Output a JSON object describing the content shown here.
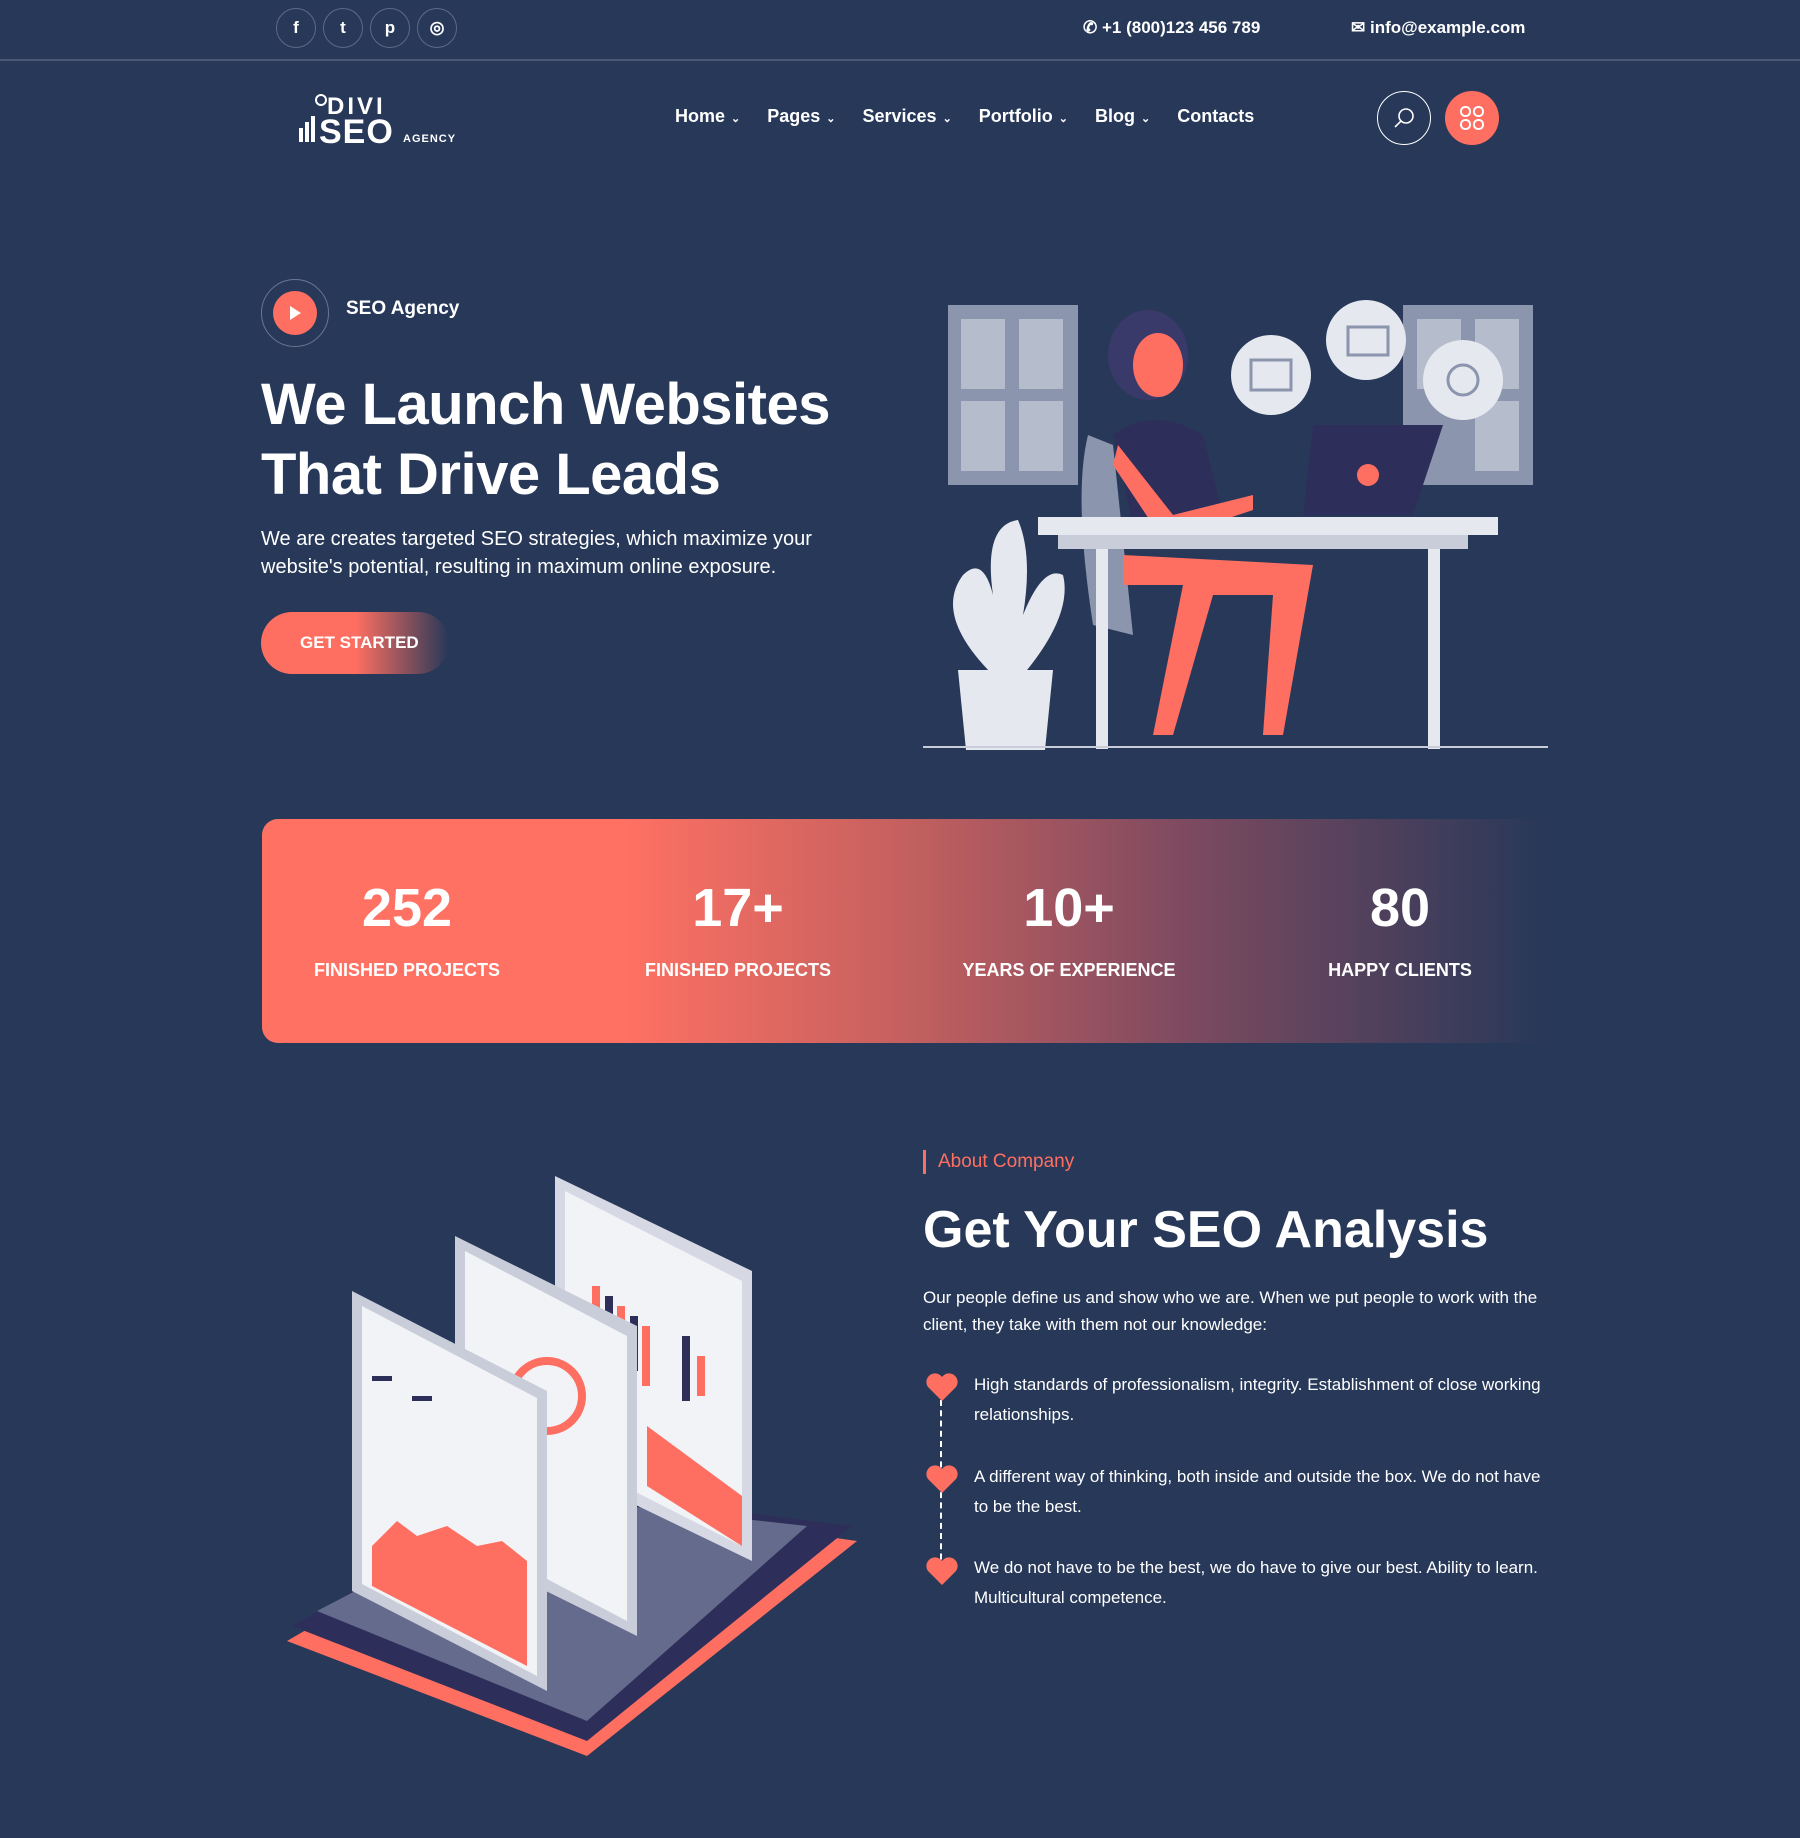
{
  "topbar": {
    "social": [
      {
        "icon": "facebook-icon",
        "glyph": "f"
      },
      {
        "icon": "twitter-icon",
        "glyph": "t"
      },
      {
        "icon": "pinterest-icon",
        "glyph": "p"
      },
      {
        "icon": "instagram-icon",
        "glyph": "◎"
      }
    ],
    "phone": "+1 (800)123 456 789",
    "email": "info@example.com"
  },
  "header": {
    "logo": {
      "line1": "DIVI",
      "line2": "SEO",
      "line3": "AGENCY"
    },
    "nav": [
      {
        "label": "Home",
        "dropdown": true
      },
      {
        "label": "Pages",
        "dropdown": true
      },
      {
        "label": "Services",
        "dropdown": true
      },
      {
        "label": "Portfolio",
        "dropdown": true
      },
      {
        "label": "Blog",
        "dropdown": true
      },
      {
        "label": "Contacts",
        "dropdown": false
      }
    ]
  },
  "hero": {
    "tag": "SEO Agency",
    "title_line1": "We Launch Websites",
    "title_line2": "That Drive Leads",
    "text": "We are creates targeted SEO strategies, which maximize your website's potential, resulting in maximum online exposure.",
    "button": "GET STARTED"
  },
  "stats": [
    {
      "value": "252",
      "label": "FINISHED PROJECTS"
    },
    {
      "value": "17+",
      "label": "FINISHED PROJECTS"
    },
    {
      "value": "10+",
      "label": "YEARS OF EXPERIENCE"
    },
    {
      "value": "80",
      "label": "HAPPY CLIENTS"
    }
  ],
  "about": {
    "label": "About Company",
    "title": "Get Your SEO Analysis",
    "text": "Our people define us and show who we are. When we put people to work with the client, they take with them not our knowledge:",
    "bullets": [
      "High standards of professionalism, integrity. Establishment of close working relationships.",
      "A different way of thinking, both inside and outside the box. We do not have to be the best.",
      "We do not have to be the best, we do have to give our best. Ability to learn. Multicultural competence."
    ]
  },
  "colors": {
    "background": "#273859",
    "accent": "#ff6f61"
  }
}
